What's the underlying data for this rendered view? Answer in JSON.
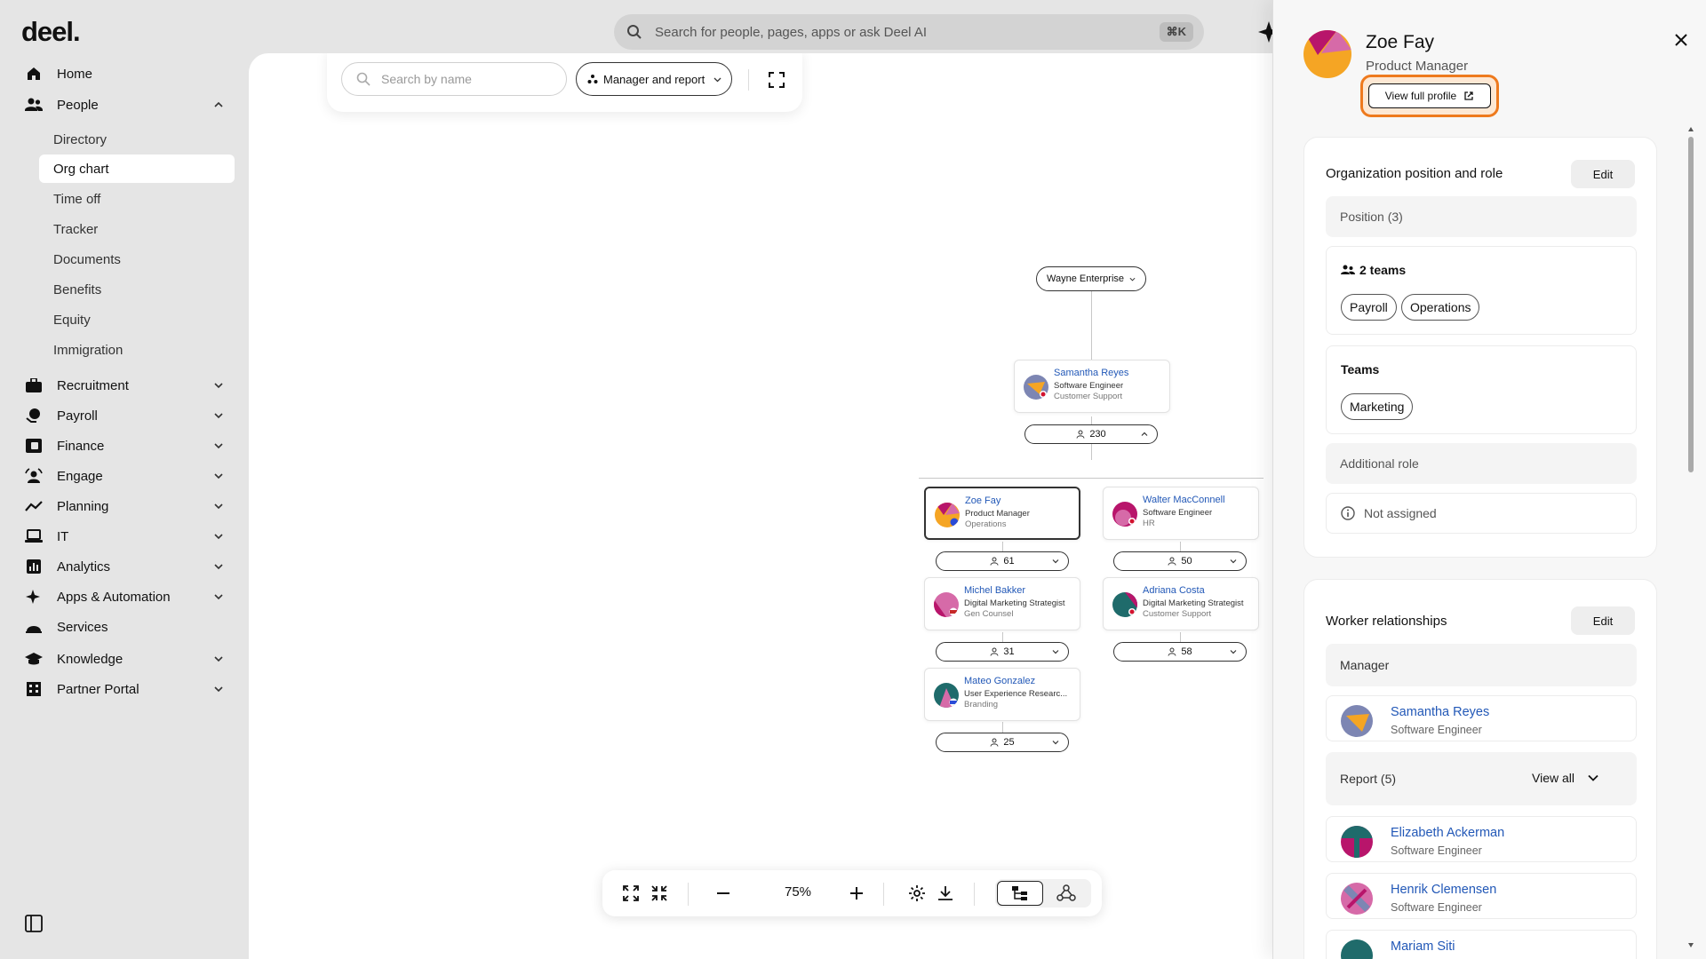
{
  "app": {
    "logo": "deel."
  },
  "top_search": {
    "placeholder": "Search for people, pages, apps or ask Deel AI",
    "shortcut": "⌘K"
  },
  "sidebar": {
    "home": "Home",
    "people": "People",
    "people_sub": [
      "Directory",
      "Org chart",
      "Time off",
      "Tracker",
      "Documents",
      "Benefits",
      "Equity",
      "Immigration"
    ],
    "active_sub": "Org chart",
    "sections": [
      "Recruitment",
      "Payroll",
      "Finance",
      "Engage",
      "Planning",
      "IT",
      "Analytics",
      "Apps & Automation",
      "Services",
      "Knowledge",
      "Partner Portal"
    ]
  },
  "org_chart": {
    "search_placeholder": "Search by name",
    "view_mode": "Manager and report",
    "root": "Wayne Enterprise",
    "nodes": [
      {
        "name": "Samantha Reyes",
        "role": "Software Engineer",
        "team": "Customer Support",
        "count": "230"
      },
      {
        "name": "Zoe Fay",
        "role": "Product Manager",
        "team": "Operations",
        "count": "61"
      },
      {
        "name": "Walter MacConnell",
        "role": "Software Engineer",
        "team": "HR",
        "count": "50"
      },
      {
        "name": "Michel Bakker",
        "role": "Digital Marketing Strategist",
        "team": "Gen Counsel",
        "count": "31"
      },
      {
        "name": "Adriana Costa",
        "role": "Digital Marketing Strategist",
        "team": "Customer Support",
        "count": "58"
      },
      {
        "name": "Mateo Gonzalez",
        "role": "User Experience Researc...",
        "team": "Branding",
        "count": "25"
      }
    ],
    "zoom": "75%"
  },
  "panel": {
    "name": "Zoe Fay",
    "title": "Product Manager",
    "view_profile": "View full profile",
    "org_section": {
      "title": "Organization position and role",
      "edit": "Edit",
      "position": "Position (3)",
      "teams_count": "2 teams",
      "team_chips": [
        "Payroll",
        "Operations"
      ],
      "teams_label": "Teams",
      "teams_chips2": [
        "Marketing"
      ],
      "additional_role": "Additional role",
      "not_assigned": "Not assigned"
    },
    "worker_section": {
      "title": "Worker relationships",
      "edit": "Edit",
      "manager_label": "Manager",
      "manager": {
        "name": "Samantha Reyes",
        "role": "Software Engineer"
      },
      "reports_label": "Report (5)",
      "view_all": "View all",
      "reports": [
        {
          "name": "Elizabeth Ackerman",
          "role": "Software Engineer"
        },
        {
          "name": "Henrik Clemensen",
          "role": "Software Engineer"
        },
        {
          "name": "Mariam Siti",
          "role": ""
        }
      ]
    }
  },
  "colors": {
    "accent_blue": "#2258b7",
    "highlight_orange": "#ee7a1e"
  }
}
